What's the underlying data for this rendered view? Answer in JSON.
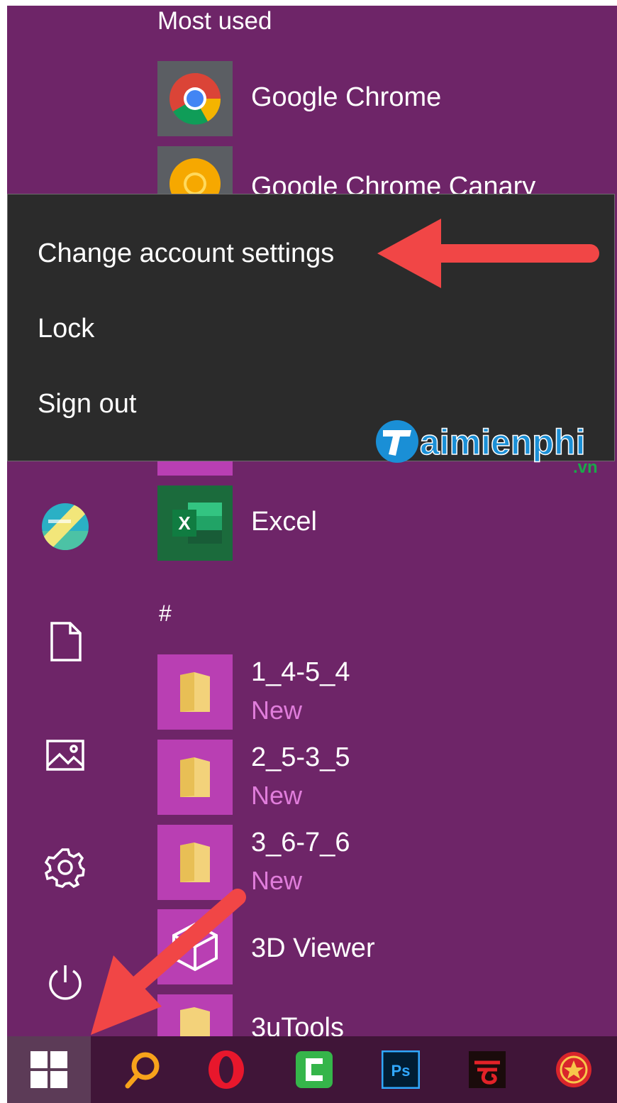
{
  "start_menu": {
    "section_most_used": "Most used",
    "apps_top": [
      {
        "name": "Google Chrome",
        "icon": "chrome-icon"
      },
      {
        "name": "Google Chrome Canary",
        "icon": "chrome-canary-icon"
      }
    ],
    "app_excel": {
      "name": "Excel",
      "icon": "excel-icon"
    },
    "section_hash": "#",
    "apps_list": [
      {
        "name": "1_4-5_4",
        "sub": "New",
        "icon": "folder-icon"
      },
      {
        "name": "2_5-3_5",
        "sub": "New",
        "icon": "folder-icon"
      },
      {
        "name": "3_6-7_6",
        "sub": "New",
        "icon": "folder-icon"
      },
      {
        "name": "3D Viewer",
        "icon": "cube-icon"
      },
      {
        "name": "3uTools",
        "icon": "folder-icon"
      }
    ]
  },
  "account_menu": {
    "items": [
      "Change account settings",
      "Lock",
      "Sign out"
    ]
  },
  "watermark": {
    "text": "aimienphi",
    "suffix": ".vn"
  },
  "left_rail": [
    "avatar",
    "document-icon",
    "pictures-icon",
    "settings-gear-icon",
    "power-icon"
  ],
  "taskbar": [
    "windows-start-icon",
    "search-icon",
    "opera-icon",
    "camtasia-icon",
    "photoshop-icon",
    "garena-icon",
    "game-icon"
  ],
  "taskbar_labels": {
    "photoshop": "Ps",
    "excel": "X"
  },
  "colors": {
    "background": "#6e2568",
    "tile": "#b93fb3",
    "popup": "#2b2b2b",
    "taskbar": "#401538",
    "arrow": "#f14646",
    "sub_text": "#e07ddb"
  }
}
